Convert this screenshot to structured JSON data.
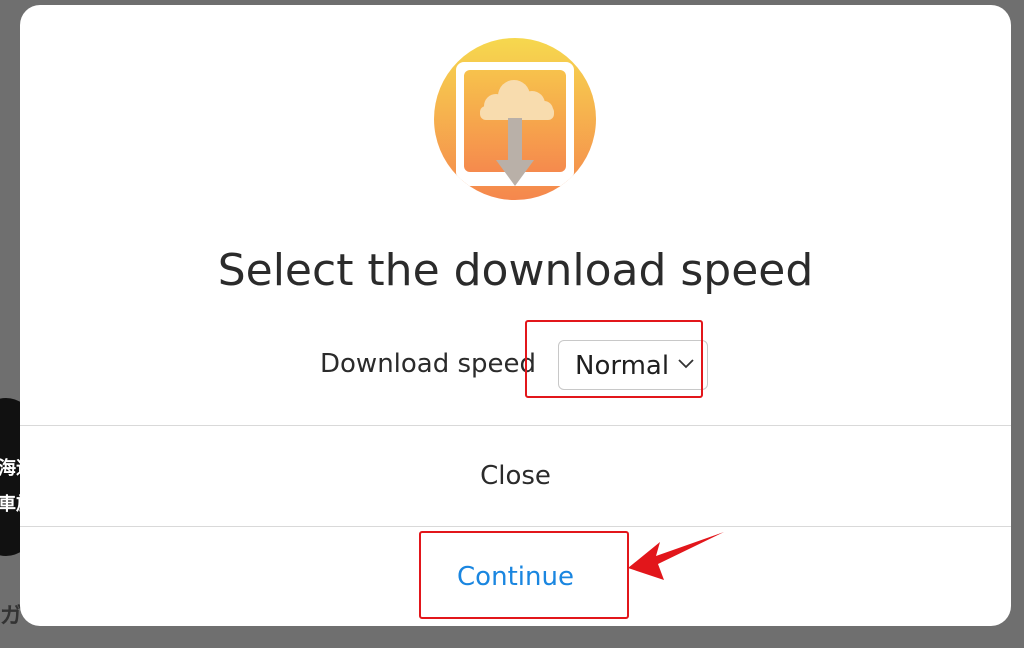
{
  "dialog": {
    "title": "Select the download speed",
    "speed_label": "Download speed",
    "speed_select": {
      "value": "Normal"
    },
    "close_label": "Close",
    "continue_label": "Continue",
    "app_icon": "download-from-cloud-app-icon"
  },
  "annotations": {
    "highlight_color": "#e2161b",
    "highlighted": [
      "speed-select",
      "continue-button"
    ]
  },
  "colors": {
    "accent": "#1a86e0",
    "icon_gradient_top": "#f6d24a",
    "icon_gradient_bottom": "#f58a4b"
  }
}
